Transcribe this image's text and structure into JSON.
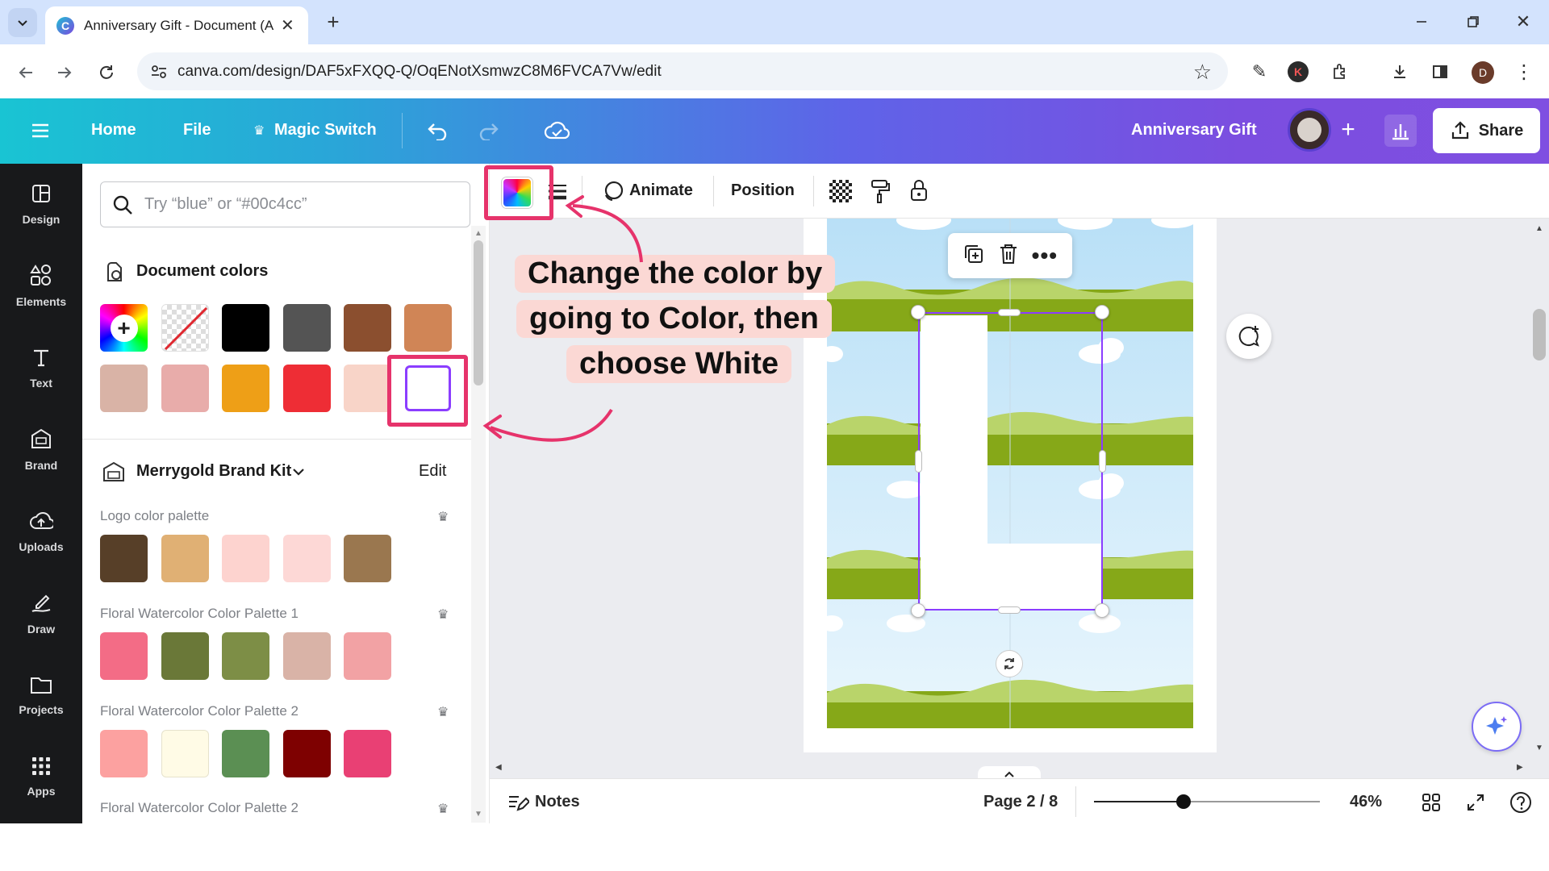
{
  "browser": {
    "tab_title": "Anniversary Gift - Document (A",
    "url": "canva.com/design/DAF5xFXQQ-Q/OqENotXsmwzC8M6FVCA7Vw/edit",
    "profile_initial": "D",
    "ext_initial": "K"
  },
  "header": {
    "home": "Home",
    "file": "File",
    "magic_switch": "Magic Switch",
    "doc_title": "Anniversary Gift",
    "share": "Share"
  },
  "rail": [
    {
      "label": "Design",
      "icon": "design-icon"
    },
    {
      "label": "Elements",
      "icon": "elements-icon"
    },
    {
      "label": "Text",
      "icon": "text-icon"
    },
    {
      "label": "Brand",
      "icon": "brand-icon"
    },
    {
      "label": "Uploads",
      "icon": "uploads-icon"
    },
    {
      "label": "Draw",
      "icon": "draw-icon"
    },
    {
      "label": "Projects",
      "icon": "projects-icon"
    },
    {
      "label": "Apps",
      "icon": "apps-icon"
    }
  ],
  "panel": {
    "search_placeholder": "Try “blue” or “#00c4cc”",
    "document_colors_title": "Document colors",
    "document_colors": [
      "#000000",
      "#545454",
      "#8b4f2f",
      "#d08556",
      "#d9b3a6",
      "#e8acaa",
      "#ee9f17",
      "#ee2d35",
      "#f8d4c8",
      "#ffffff"
    ],
    "brand_kit_title": "Merrygold Brand Kit",
    "edit_label": "Edit",
    "palettes": [
      {
        "name": "Logo color palette",
        "colors": [
          "#573f28",
          "#e0b074",
          "#fdd3cf",
          "#fdd8d6",
          "#9a774f"
        ]
      },
      {
        "name": "Floral Watercolor Color Palette 1",
        "colors": [
          "#f36c86",
          "#6a7838",
          "#7d8e46",
          "#d9b3a7",
          "#f2a2a4"
        ]
      },
      {
        "name": "Floral Watercolor Color Palette 2",
        "colors": [
          "#fca1a0",
          "#fffbe6",
          "#5b8f53",
          "#7e0101",
          "#e94074"
        ]
      },
      {
        "name": "Floral Watercolor Color Palette 2",
        "colors": []
      }
    ]
  },
  "toolbar": {
    "animate": "Animate",
    "position": "Position"
  },
  "annotation": {
    "line1": "Change the color by",
    "line2": "going to Color, then",
    "line3": "choose White"
  },
  "bottom": {
    "notes": "Notes",
    "page": "Page 2 / 8",
    "zoom": "46%",
    "zoom_level": 0.46
  }
}
